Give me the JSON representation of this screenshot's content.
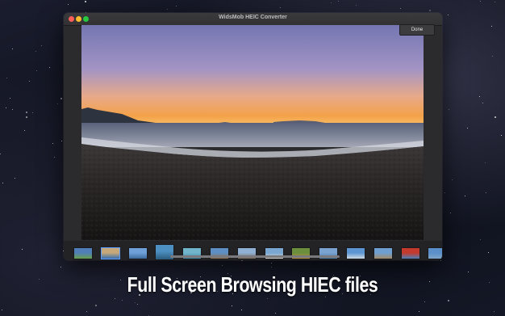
{
  "window": {
    "title": "WidsMob HEIC Converter",
    "done_label": "Done"
  },
  "preview": {
    "subject": "beach-sunset-photo"
  },
  "thumbnails": [
    {
      "colors": [
        "#4f7fb6",
        "#6aa04c"
      ]
    },
    {
      "colors": [
        "#c7a87a",
        "#3a6fb0"
      ],
      "selected": true
    },
    {
      "colors": [
        "#6fa1d8",
        "#3c6a9c"
      ]
    },
    {
      "colors": [
        "#4d8fc0",
        "#2a5b7c"
      ],
      "raised": true
    },
    {
      "colors": [
        "#70b5c9",
        "#3e86a8"
      ]
    },
    {
      "colors": [
        "#5d8ec4",
        "#8f6f4f"
      ]
    },
    {
      "colors": [
        "#8fb0d3",
        "#7b6a5a"
      ]
    },
    {
      "colors": [
        "#7aa7d2",
        "#d6d4cc"
      ]
    },
    {
      "colors": [
        "#6c8f3d",
        "#b9913d"
      ]
    },
    {
      "colors": [
        "#7aa3cf",
        "#4a7ba6"
      ]
    },
    {
      "colors": [
        "#5c95d1",
        "#cfd9e4"
      ]
    },
    {
      "colors": [
        "#6f9fd0",
        "#a38b68"
      ]
    },
    {
      "colors": [
        "#c43a2c",
        "#4c7fb8"
      ]
    },
    {
      "colors": [
        "#5a8fc9",
        "#7fa6c9"
      ]
    }
  ],
  "caption": "Full Screen Browsing HIEC files",
  "colors": {
    "accent": "#5b9cff",
    "sky_top": "#7a7fb8",
    "horizon": "#f0a04a"
  }
}
